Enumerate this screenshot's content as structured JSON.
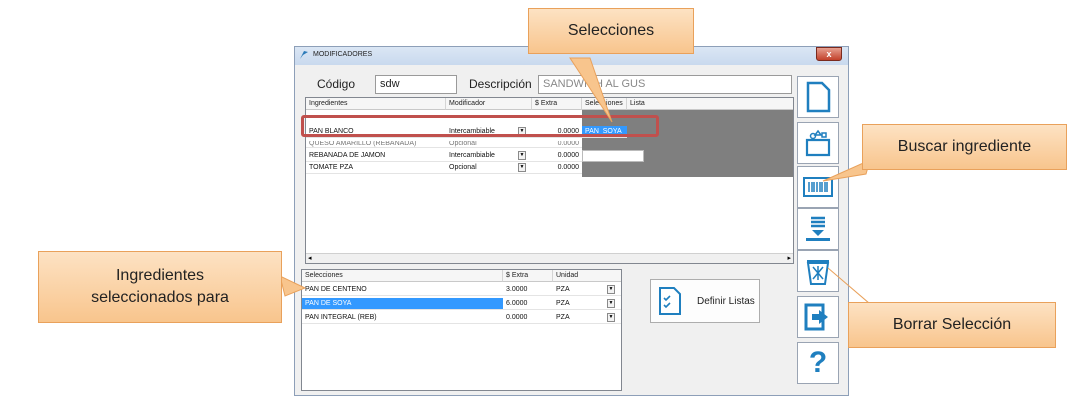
{
  "window": {
    "title": "MODIFICADORES",
    "close_label": "x"
  },
  "header": {
    "codigo_label": "Código",
    "codigo_value": "sdw",
    "descripcion_label": "Descripción",
    "descripcion_value": "SANDWICH AL GUS"
  },
  "ingredients_table": {
    "headers": [
      "Ingredientes",
      "Modificador",
      "$ Extra",
      "Selecciones",
      "Lista"
    ],
    "rows": [
      {
        "ingrediente": "PAN BLANCO",
        "modificador": "Intercambiable",
        "extra": "0.0000",
        "selecciones": "PAN_SOYA"
      },
      {
        "ingrediente": "QUESO AMARILLO (REBANADA)",
        "modificador": "Opcional",
        "extra": "0.0000",
        "selecciones": ""
      },
      {
        "ingrediente": "REBANADA DE JAMON",
        "modificador": "Intercambiable",
        "extra": "0.0000",
        "selecciones": ""
      },
      {
        "ingrediente": "TOMATE PZA",
        "modificador": "Opcional",
        "extra": "0.0000",
        "selecciones": ""
      }
    ]
  },
  "selections_table": {
    "headers": [
      "Selecciones",
      "$ Extra",
      "Unidad"
    ],
    "rows": [
      {
        "seleccion": "PAN DE CENTENO",
        "extra": "3.0000",
        "unidad": "PZA"
      },
      {
        "seleccion": "PAN DE SOYA",
        "extra": "6.0000",
        "unidad": "PZA"
      },
      {
        "seleccion": "PAN INTEGRAL (REB)",
        "extra": "0.0000",
        "unidad": "PZA"
      }
    ]
  },
  "buttons": {
    "definir_listas": "Definir Listas"
  },
  "side_toolbar": [
    "new-document-icon",
    "basket-icon",
    "barcode-icon",
    "download-icon",
    "trash-icon",
    "exit-icon",
    "help-icon"
  ],
  "callouts": {
    "selecciones": "Selecciones",
    "buscar": "Buscar ingrediente",
    "ingredientes": "Ingredientes seleccionados para",
    "borrar": "Borrar Selección"
  },
  "colors": {
    "highlight_border": "#c0504d",
    "callout_fill": "#f8c58d",
    "selected_row": "#3399ff",
    "icon_blue": "#1f7fbf"
  }
}
